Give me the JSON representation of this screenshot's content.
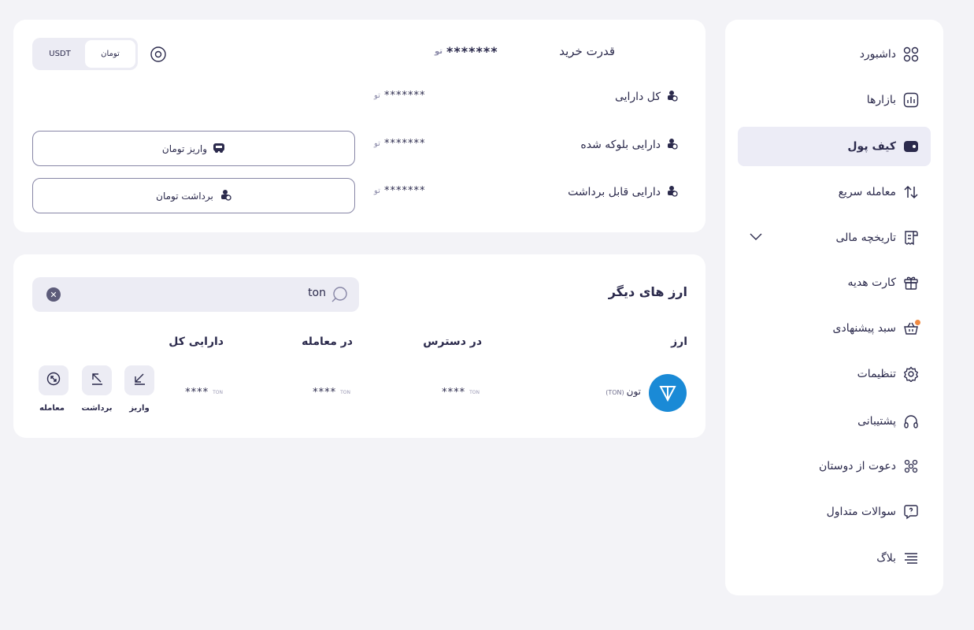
{
  "sidebar": {
    "items": [
      {
        "label": "داشبورد",
        "icon": "dashboard-icon"
      },
      {
        "label": "بازارها",
        "icon": "markets-icon"
      },
      {
        "label": "کیف پول",
        "icon": "wallet-icon"
      },
      {
        "label": "معامله سریع",
        "icon": "swap-arrows-icon"
      },
      {
        "label": "تاریخچه مالی",
        "icon": "receipt-icon"
      },
      {
        "label": "کارت هدیه",
        "icon": "gift-icon"
      },
      {
        "label": "سبد پیشنهادی",
        "icon": "basket-icon"
      },
      {
        "label": "تنظیمات",
        "icon": "gear-icon"
      },
      {
        "label": "پشتیبانی",
        "icon": "headset-icon"
      },
      {
        "label": "دعوت از دوستان",
        "icon": "users-icon"
      },
      {
        "label": "سوالات متداول",
        "icon": "faq-icon"
      },
      {
        "label": "بلاگ",
        "icon": "menu-lines-icon"
      }
    ]
  },
  "summary": {
    "buying_power": {
      "label": "قدرت خرید",
      "value": "*******"
    },
    "rows": [
      {
        "label": "کل دارایی",
        "value": "*******"
      },
      {
        "label": "دارایی بلوکه شده",
        "value": "*******"
      },
      {
        "label": "دارایی قابل برداشت",
        "value": "*******"
      }
    ],
    "currency_toggle": {
      "options": [
        "تومان",
        "USDT"
      ],
      "selected": "تومان"
    },
    "deposit_button": "واریز تومان",
    "withdraw_button": "برداشت تومان"
  },
  "assets": {
    "title": "ارز های دیگر",
    "search": {
      "value": "ton"
    },
    "columns": [
      "ارز",
      "در دسترس",
      "در معامله",
      "دارایی کل"
    ],
    "rows": [
      {
        "name": "تون",
        "symbol": "(TON)",
        "available": "****",
        "in_trade": "****",
        "total": "****",
        "unit": "TON"
      }
    ],
    "actions": [
      "واریز",
      "برداشت",
      "معامله"
    ]
  },
  "colors": {
    "background": "#f3f3f7",
    "text": "#2b2a4c",
    "active_nav": "#ececf6",
    "ton_brand": "#1a8ad6",
    "notification_dot": "#f08a42"
  }
}
